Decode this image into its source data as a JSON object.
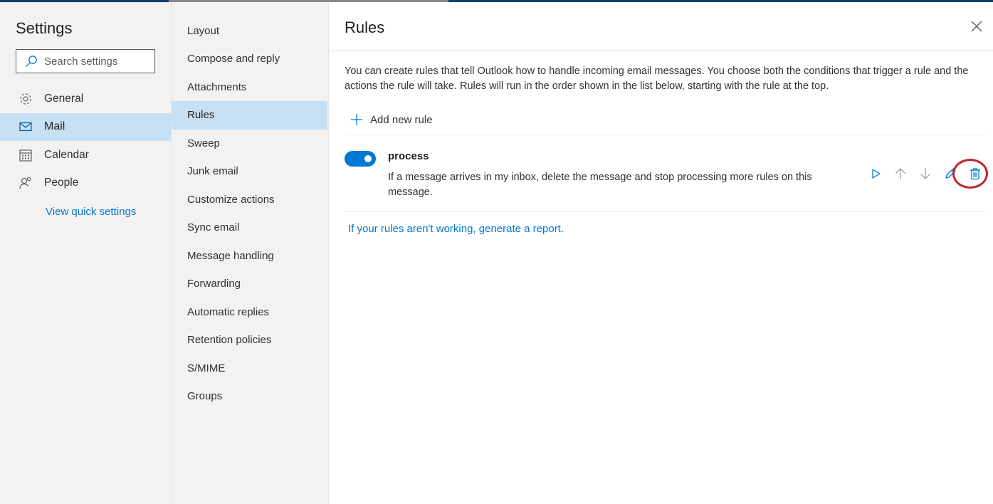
{
  "settings": {
    "title": "Settings",
    "search_placeholder": "Search settings",
    "nav": [
      {
        "label": "General",
        "icon": "gear-icon"
      },
      {
        "label": "Mail",
        "icon": "mail-icon",
        "active": true
      },
      {
        "label": "Calendar",
        "icon": "calendar-icon"
      },
      {
        "label": "People",
        "icon": "people-icon"
      }
    ],
    "quick_settings": "View quick settings"
  },
  "mail_nav": {
    "items": [
      "Layout",
      "Compose and reply",
      "Attachments",
      "Rules",
      "Sweep",
      "Junk email",
      "Customize actions",
      "Sync email",
      "Message handling",
      "Forwarding",
      "Automatic replies",
      "Retention policies",
      "S/MIME",
      "Groups"
    ],
    "active": "Rules"
  },
  "rules": {
    "title": "Rules",
    "description": "You can create rules that tell Outlook how to handle incoming email messages. You choose both the conditions that trigger a rule and the actions the rule will take. Rules will run in the order shown in the list below, starting with the rule at the top.",
    "add_rule": "Add new rule",
    "items": [
      {
        "name": "process",
        "enabled": true,
        "description": "If a message arrives in my inbox, delete the message and stop processing more rules on this message."
      }
    ],
    "report_link": "If your rules aren't working, generate a report."
  },
  "colors": {
    "accent": "#0078d4",
    "selected_bg": "#c7e0f4",
    "nav_bg": "#f3f2f1",
    "highlight_circle": "#c0262c"
  }
}
